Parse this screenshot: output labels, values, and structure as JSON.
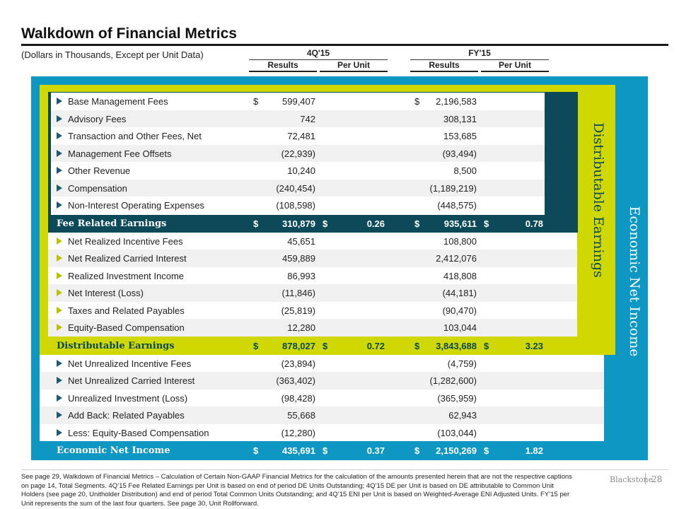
{
  "header": {
    "title": "Walkdown of Financial Metrics",
    "units_note": "(Dollars in Thousands, Except per Unit Data)"
  },
  "columns": {
    "q4": {
      "group": "4Q'15",
      "results": "Results",
      "per_unit": "Per Unit"
    },
    "fy": {
      "group": "FY'15",
      "results": "Results",
      "per_unit": "Per Unit"
    }
  },
  "bands": {
    "fee_earnings": "Fee Earnings",
    "distributable_earnings": "Distributable Earnings",
    "economic_net_income": "Economic Net Income"
  },
  "fee_rows": [
    {
      "label": "Base Management Fees",
      "q4_dollar": "$",
      "q4": "599,407",
      "fy_dollar": "$",
      "fy": "2,196,583"
    },
    {
      "label": "Advisory Fees",
      "q4": "742",
      "fy": "308,131"
    },
    {
      "label": "Transaction and Other Fees, Net",
      "q4": "72,481",
      "fy": "153,685"
    },
    {
      "label": "Management Fee Offsets",
      "q4": "(22,939)",
      "fy": "(93,494)"
    },
    {
      "label": "Other Revenue",
      "q4": "10,240",
      "fy": "8,500"
    },
    {
      "label": "Compensation",
      "q4": "(240,454)",
      "fy": "(1,189,219)"
    },
    {
      "label": "Non-Interest Operating Expenses",
      "q4": "(108,598)",
      "fy": "(448,575)"
    }
  ],
  "fee_total": {
    "label": "Fee Related Earnings",
    "dollar": "$",
    "q4": "310,879",
    "q4_pu": "0.26",
    "fy": "935,611",
    "fy_pu": "0.78"
  },
  "de_rows": [
    {
      "label": "Net Realized Incentive Fees",
      "q4": "45,651",
      "fy": "108,800"
    },
    {
      "label": "Net Realized Carried Interest",
      "q4": "459,889",
      "fy": "2,412,076"
    },
    {
      "label": "Realized Investment Income",
      "q4": "86,993",
      "fy": "418,808"
    },
    {
      "label": "Net Interest (Loss)",
      "q4": "(11,846)",
      "fy": "(44,181)"
    },
    {
      "label": "Taxes and Related Payables",
      "q4": "(25,819)",
      "fy": "(90,470)"
    },
    {
      "label": "Equity-Based Compensation",
      "q4": "12,280",
      "fy": "103,044"
    }
  ],
  "de_total": {
    "label": "Distributable Earnings",
    "dollar": "$",
    "q4": "878,027",
    "q4_pu": "0.72",
    "fy": "3,843,688",
    "fy_pu": "3.23"
  },
  "eni_rows": [
    {
      "label": "Net Unrealized Incentive Fees",
      "q4": "(23,894)",
      "fy": "(4,759)"
    },
    {
      "label": "Net Unrealized Carried Interest",
      "q4": "(363,402)",
      "fy": "(1,282,600)"
    },
    {
      "label": "Unrealized Investment (Loss)",
      "q4": "(98,428)",
      "fy": "(365,959)"
    },
    {
      "label": "Add Back: Related Payables",
      "q4": "55,668",
      "fy": "62,943"
    },
    {
      "label": "Less: Equity-Based Compensation",
      "q4": "(12,280)",
      "fy": "(103,044)"
    }
  ],
  "eni_total": {
    "label": "Economic Net Income",
    "dollar": "$",
    "q4": "435,691",
    "q4_pu": "0.37",
    "fy": "2,150,269",
    "fy_pu": "1.82"
  },
  "footer": {
    "note": "See page 29, Walkdown of Financial Metrics – Calculation of Certain Non-GAAP Financial Metrics for the calculation of the amounts presented herein that are not the respective captions on page 14, Total Segments. 4Q’15 Fee Related Earnings per Unit is based on end of period DE Units Outstanding; 4Q’15 DE per Unit is based on DE attributable to Common Unit Holders (see page 20, Unitholder Distribution) and end of period Total Common Units Outstanding; and 4Q’15 ENI per Unit is based on Weighted-Average ENI Adjusted Units. FY’15 per Unit represents the sum of the last four quarters. See page 30, Unit Rollforward.",
    "brand": "Blackstone",
    "page_number": "28"
  },
  "colors": {
    "fee_band": "#0c4a5a",
    "de_band": "#cfd800",
    "eni_band": "#0f97c3"
  }
}
